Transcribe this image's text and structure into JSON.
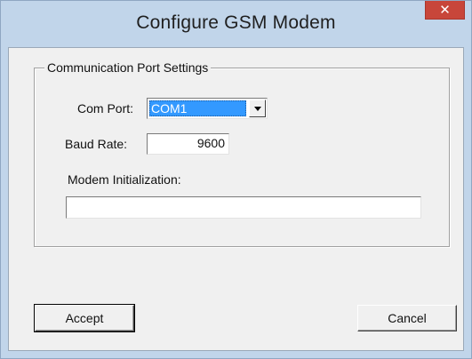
{
  "window": {
    "title": "Configure GSM Modem",
    "close_glyph": "✕"
  },
  "group": {
    "title": "Communication Port Settings"
  },
  "com_port": {
    "label": "Com Port:",
    "value": "COM1",
    "dropdown_icon": "chevron-down-icon"
  },
  "baud_rate": {
    "label": "Baud Rate:",
    "value": "9600"
  },
  "modem_init": {
    "label": "Modem Initialization:",
    "value": ""
  },
  "buttons": {
    "accept_label": "Accept",
    "cancel_label": "Cancel"
  },
  "colors": {
    "titlebar": "#c1d5ea",
    "close_button": "#c8463a",
    "selection": "#3399ff",
    "dialog_face": "#f0f0f0"
  }
}
